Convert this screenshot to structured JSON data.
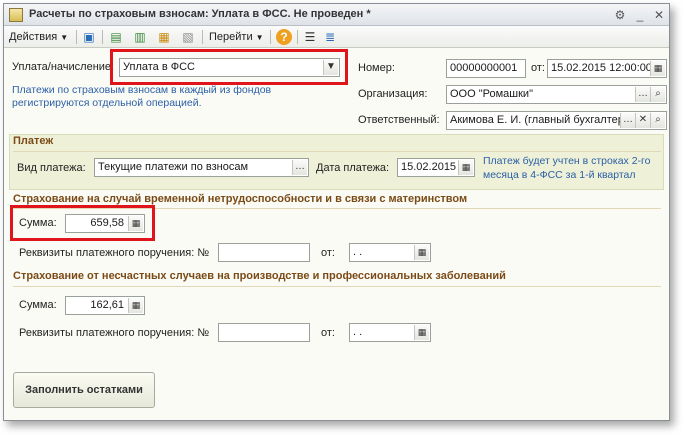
{
  "window": {
    "title": "Расчеты по страховым взносам: Уплата в ФСС. Не проведен *"
  },
  "toolbar": {
    "actions_label": "Действия",
    "goto_label": "Перейти",
    "help_glyph": "?"
  },
  "form": {
    "payment_type_label": "Уплата/начисление:",
    "payment_type_value": "Уплата в ФСС",
    "hint_text_1": "Платежи по страховым взносам в каждый из фондов",
    "hint_text_2": "регистрируются отдельной операцией.",
    "number_label": "Номер:",
    "number_value": "00000000001",
    "date_from_label": "от:",
    "date_value": "15.02.2015 12:00:00",
    "org_label": "Организация:",
    "org_value": "ООО \"Ромашки\"",
    "resp_label": "Ответственный:",
    "resp_value": "Акимова Е. И. (главный бухгалтер)"
  },
  "payment_section": {
    "title": "Платеж",
    "kind_label": "Вид платежа:",
    "kind_value": "Текущие платежи по взносам",
    "date_label": "Дата платежа:",
    "date_value": "15.02.2015",
    "note_1": "Платеж будет учтен в строках 2-го",
    "note_2": "месяца в 4-ФСС за 1-й квартал"
  },
  "insurance_temp": {
    "title": "Страхование на случай временной нетрудоспособности и в связи с материнством",
    "sum_label": "Сумма:",
    "sum_value": "659,58",
    "req_label": "Реквизиты платежного поручения: №",
    "req_value": "",
    "from_label": "от:",
    "date_value": " .  ."
  },
  "insurance_accident": {
    "title": "Страхование от несчастных случаев на производстве и профессиональных заболеваний",
    "sum_label": "Сумма:",
    "sum_value": "162,61",
    "req_label": "Реквизиты платежного поручения: №",
    "req_value": "",
    "from_label": "от:",
    "date_value": " .  ."
  },
  "fill_button_label": "Заполнить остатками",
  "colors": {
    "highlight": "#e0151b",
    "section_header": "#7a4b16",
    "hint_blue": "#2b5fa6",
    "panel_bg": "#eef1d8"
  },
  "icons": {
    "calendar": "calendar-icon",
    "dropdown": "chevron-down-icon",
    "search": "search-icon",
    "clear": "close-icon",
    "ellipsis": "ellipsis-icon"
  }
}
